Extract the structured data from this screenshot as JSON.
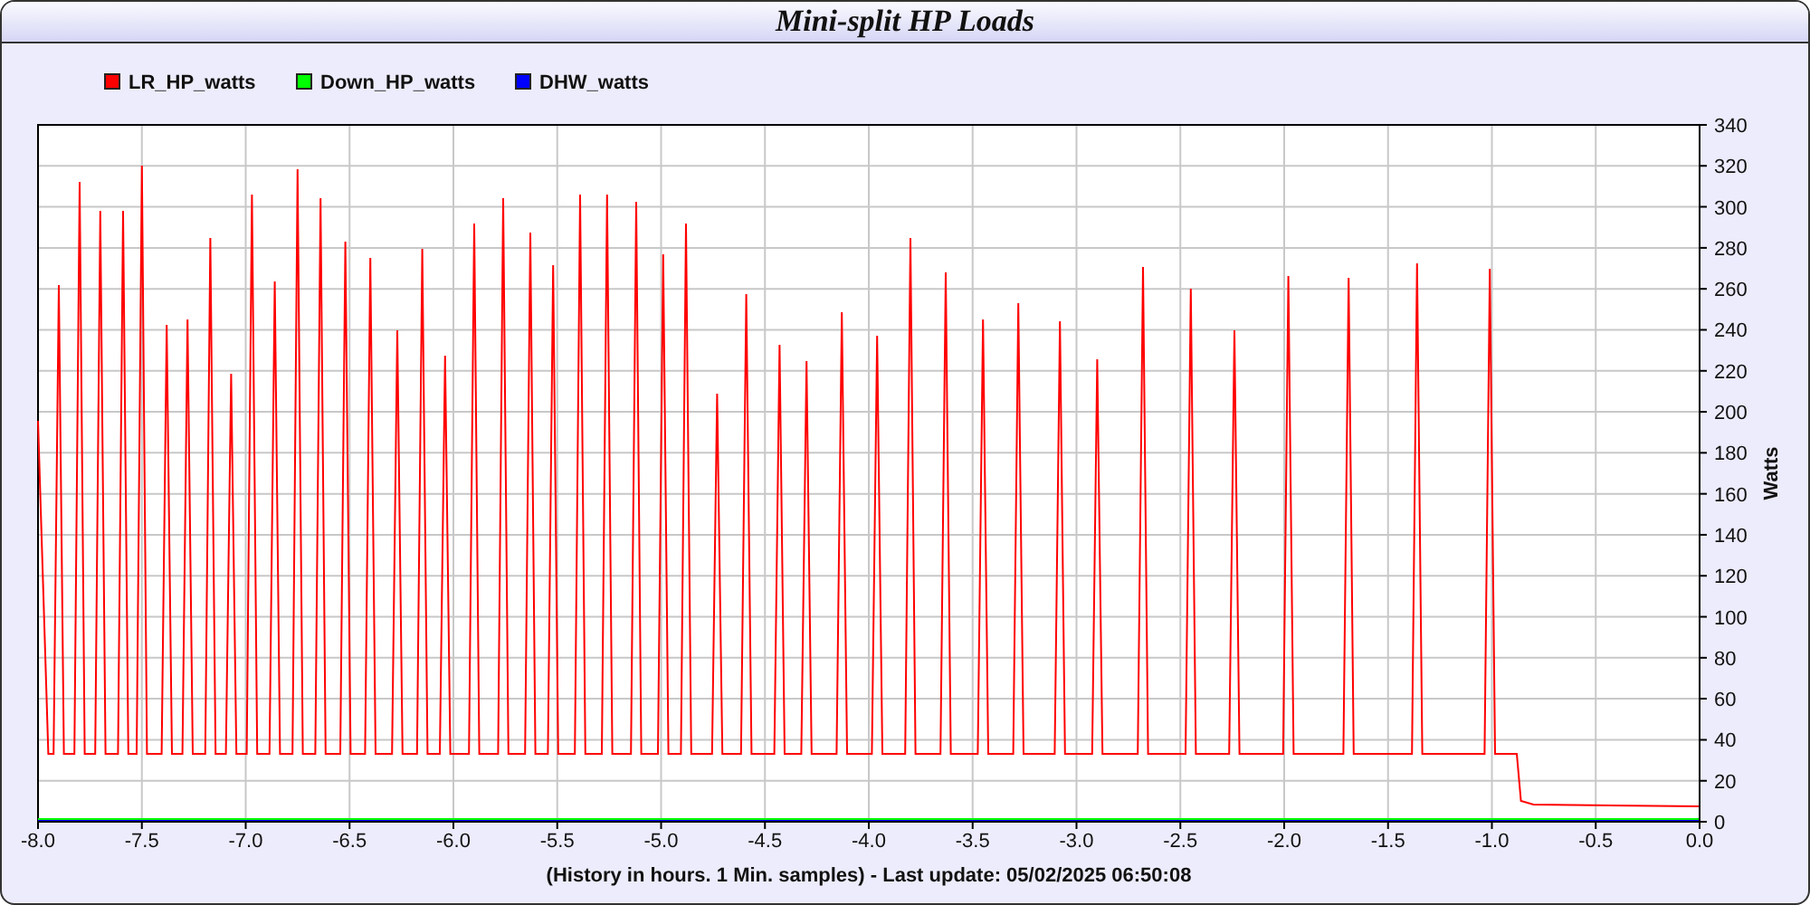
{
  "chart_data": {
    "type": "line",
    "title": "Mini-split HP Loads",
    "xlabel": "(History in hours. 1 Min. samples) - Last update: 05/02/2025 06:50:08",
    "ylabel": "Watts",
    "grid": true,
    "legend": true,
    "xlim": [
      -8,
      0
    ],
    "ylim": [
      0,
      340
    ],
    "xticks": [
      {
        "value": -8,
        "label": "-8.0"
      },
      {
        "value": -7.5,
        "label": "-7.5"
      },
      {
        "value": -7,
        "label": "-7.0"
      },
      {
        "value": -6.5,
        "label": "-6.5"
      },
      {
        "value": -6,
        "label": "-6.0"
      },
      {
        "value": -5.5,
        "label": "-5.5"
      },
      {
        "value": -5,
        "label": "-5.0"
      },
      {
        "value": -4.5,
        "label": "-4.5"
      },
      {
        "value": -4,
        "label": "-4.0"
      },
      {
        "value": -3.5,
        "label": "-3.5"
      },
      {
        "value": -3,
        "label": "-3.0"
      },
      {
        "value": -2.5,
        "label": "-2.5"
      },
      {
        "value": -2,
        "label": "-2.0"
      },
      {
        "value": -1.5,
        "label": "-1.5"
      },
      {
        "value": -1,
        "label": "-1.0"
      },
      {
        "value": -0.5,
        "label": "-0.5"
      },
      {
        "value": 0,
        "label": "0.0"
      }
    ],
    "yticks": [
      0,
      20,
      40,
      60,
      80,
      100,
      120,
      140,
      160,
      180,
      200,
      220,
      240,
      260,
      280,
      300,
      320,
      340
    ],
    "x": [
      -8.0,
      -7.95,
      -7.925,
      -7.9,
      -7.875,
      -7.825,
      -7.8,
      -7.775,
      -7.725,
      -7.7,
      -7.675,
      -7.615,
      -7.59,
      -7.565,
      -7.525,
      -7.5,
      -7.475,
      -7.405,
      -7.38,
      -7.355,
      -7.305,
      -7.28,
      -7.255,
      -7.195,
      -7.17,
      -7.145,
      -7.095,
      -7.07,
      -7.045,
      -6.995,
      -6.97,
      -6.945,
      -6.885,
      -6.86,
      -6.835,
      -6.775,
      -6.75,
      -6.725,
      -6.665,
      -6.64,
      -6.615,
      -6.545,
      -6.52,
      -6.495,
      -6.425,
      -6.4,
      -6.375,
      -6.295,
      -6.27,
      -6.245,
      -6.175,
      -6.15,
      -6.125,
      -6.065,
      -6.04,
      -6.015,
      -5.925,
      -5.9,
      -5.875,
      -5.785,
      -5.76,
      -5.735,
      -5.655,
      -5.63,
      -5.605,
      -5.545,
      -5.52,
      -5.495,
      -5.415,
      -5.39,
      -5.365,
      -5.285,
      -5.26,
      -5.235,
      -5.145,
      -5.12,
      -5.095,
      -5.015,
      -4.99,
      -4.965,
      -4.905,
      -4.88,
      -4.855,
      -4.755,
      -4.73,
      -4.705,
      -4.615,
      -4.59,
      -4.565,
      -4.455,
      -4.43,
      -4.405,
      -4.325,
      -4.3,
      -4.275,
      -4.155,
      -4.13,
      -4.105,
      -3.985,
      -3.96,
      -3.935,
      -3.825,
      -3.8,
      -3.775,
      -3.655,
      -3.63,
      -3.605,
      -3.475,
      -3.45,
      -3.425,
      -3.305,
      -3.28,
      -3.255,
      -3.105,
      -3.08,
      -3.055,
      -2.925,
      -2.9,
      -2.875,
      -2.705,
      -2.68,
      -2.655,
      -2.475,
      -2.45,
      -2.425,
      -2.265,
      -2.24,
      -2.215,
      -2.005,
      -1.98,
      -1.955,
      -1.715,
      -1.69,
      -1.665,
      -1.385,
      -1.36,
      -1.335,
      -1.035,
      -1.01,
      -0.985,
      -0.88,
      -0.86,
      -0.8,
      0.0
    ],
    "series": [
      {
        "name": "LR_HP_watts",
        "color": "#ff0000",
        "values": [
          195,
          33,
          33,
          261,
          33,
          33,
          312,
          33,
          33,
          298,
          33,
          33,
          298,
          33,
          33,
          320,
          33,
          33,
          242,
          33,
          33,
          245,
          33,
          33,
          284,
          33,
          33,
          218,
          33,
          33,
          306,
          33,
          33,
          263,
          33,
          33,
          318,
          33,
          33,
          304,
          33,
          33,
          283,
          33,
          33,
          275,
          33,
          33,
          239,
          33,
          33,
          279,
          33,
          33,
          227,
          33,
          33,
          291,
          33,
          33,
          304,
          33,
          33,
          287,
          33,
          33,
          271,
          33,
          33,
          306,
          33,
          33,
          306,
          33,
          33,
          302,
          33,
          33,
          276,
          33,
          33,
          291,
          33,
          33,
          208,
          33,
          33,
          257,
          33,
          33,
          232,
          33,
          33,
          224,
          33,
          33,
          248,
          33,
          33,
          237,
          33,
          33,
          284,
          33,
          33,
          268,
          33,
          33,
          245,
          33,
          33,
          253,
          33,
          33,
          244,
          33,
          33,
          225,
          33,
          33,
          270,
          33,
          33,
          260,
          33,
          33,
          239,
          33,
          33,
          266,
          33,
          33,
          265,
          33,
          33,
          272,
          33,
          33,
          269,
          33,
          33,
          10,
          8,
          7
        ]
      },
      {
        "name": "Down_HP_watts",
        "color": "#00ff00",
        "values": [
          1,
          1,
          1,
          1,
          1,
          1,
          1,
          1,
          1,
          1,
          1,
          1,
          1,
          1,
          1,
          1,
          1,
          1,
          1,
          1,
          1,
          1,
          1,
          1,
          1,
          1,
          1,
          1,
          1,
          1,
          1,
          1,
          1,
          1,
          1,
          1,
          1,
          1,
          1,
          1,
          1,
          1,
          1,
          1,
          1,
          1,
          1,
          1,
          1,
          1,
          1,
          1,
          1,
          1,
          1,
          1,
          1,
          1,
          1,
          1,
          1,
          1,
          1,
          1,
          1,
          1,
          1,
          1,
          1,
          1,
          1,
          1,
          1,
          1,
          1,
          1,
          1,
          1,
          1,
          1,
          1,
          1,
          1,
          1,
          1,
          1,
          1,
          1,
          1,
          1,
          1,
          1,
          1,
          1,
          1,
          1,
          1,
          1,
          1,
          1,
          1,
          1,
          1,
          1,
          1,
          1,
          1,
          1,
          1,
          1,
          1,
          1,
          1,
          1,
          1,
          1,
          1,
          1,
          1,
          1,
          1,
          1,
          1,
          1,
          1,
          1,
          1,
          1,
          1,
          1,
          1,
          1,
          1,
          1,
          1,
          1,
          1,
          1,
          1,
          1,
          1,
          1,
          1,
          1
        ]
      },
      {
        "name": "DHW_watts",
        "color": "#0000ff",
        "values": [
          0,
          0,
          0,
          0,
          0,
          0,
          0,
          0,
          0,
          0,
          0,
          0,
          0,
          0,
          0,
          0,
          0,
          0,
          0,
          0,
          0,
          0,
          0,
          0,
          0,
          0,
          0,
          0,
          0,
          0,
          0,
          0,
          0,
          0,
          0,
          0,
          0,
          0,
          0,
          0,
          0,
          0,
          0,
          0,
          0,
          0,
          0,
          0,
          0,
          0,
          0,
          0,
          0,
          0,
          0,
          0,
          0,
          0,
          0,
          0,
          0,
          0,
          0,
          0,
          0,
          0,
          0,
          0,
          0,
          0,
          0,
          0,
          0,
          0,
          0,
          0,
          0,
          0,
          0,
          0,
          0,
          0,
          0,
          0,
          0,
          0,
          0,
          0,
          0,
          0,
          0,
          0,
          0,
          0,
          0,
          0,
          0,
          0,
          0,
          0,
          0,
          0,
          0,
          0,
          0,
          0,
          0,
          0,
          0,
          0,
          0,
          0,
          0,
          0,
          0,
          0,
          0,
          0,
          0,
          0,
          0,
          0,
          0,
          0,
          0,
          0,
          0,
          0,
          0,
          0,
          0,
          0,
          0,
          0,
          0,
          0,
          0,
          0,
          0,
          0,
          0,
          0,
          0,
          0
        ]
      }
    ]
  }
}
